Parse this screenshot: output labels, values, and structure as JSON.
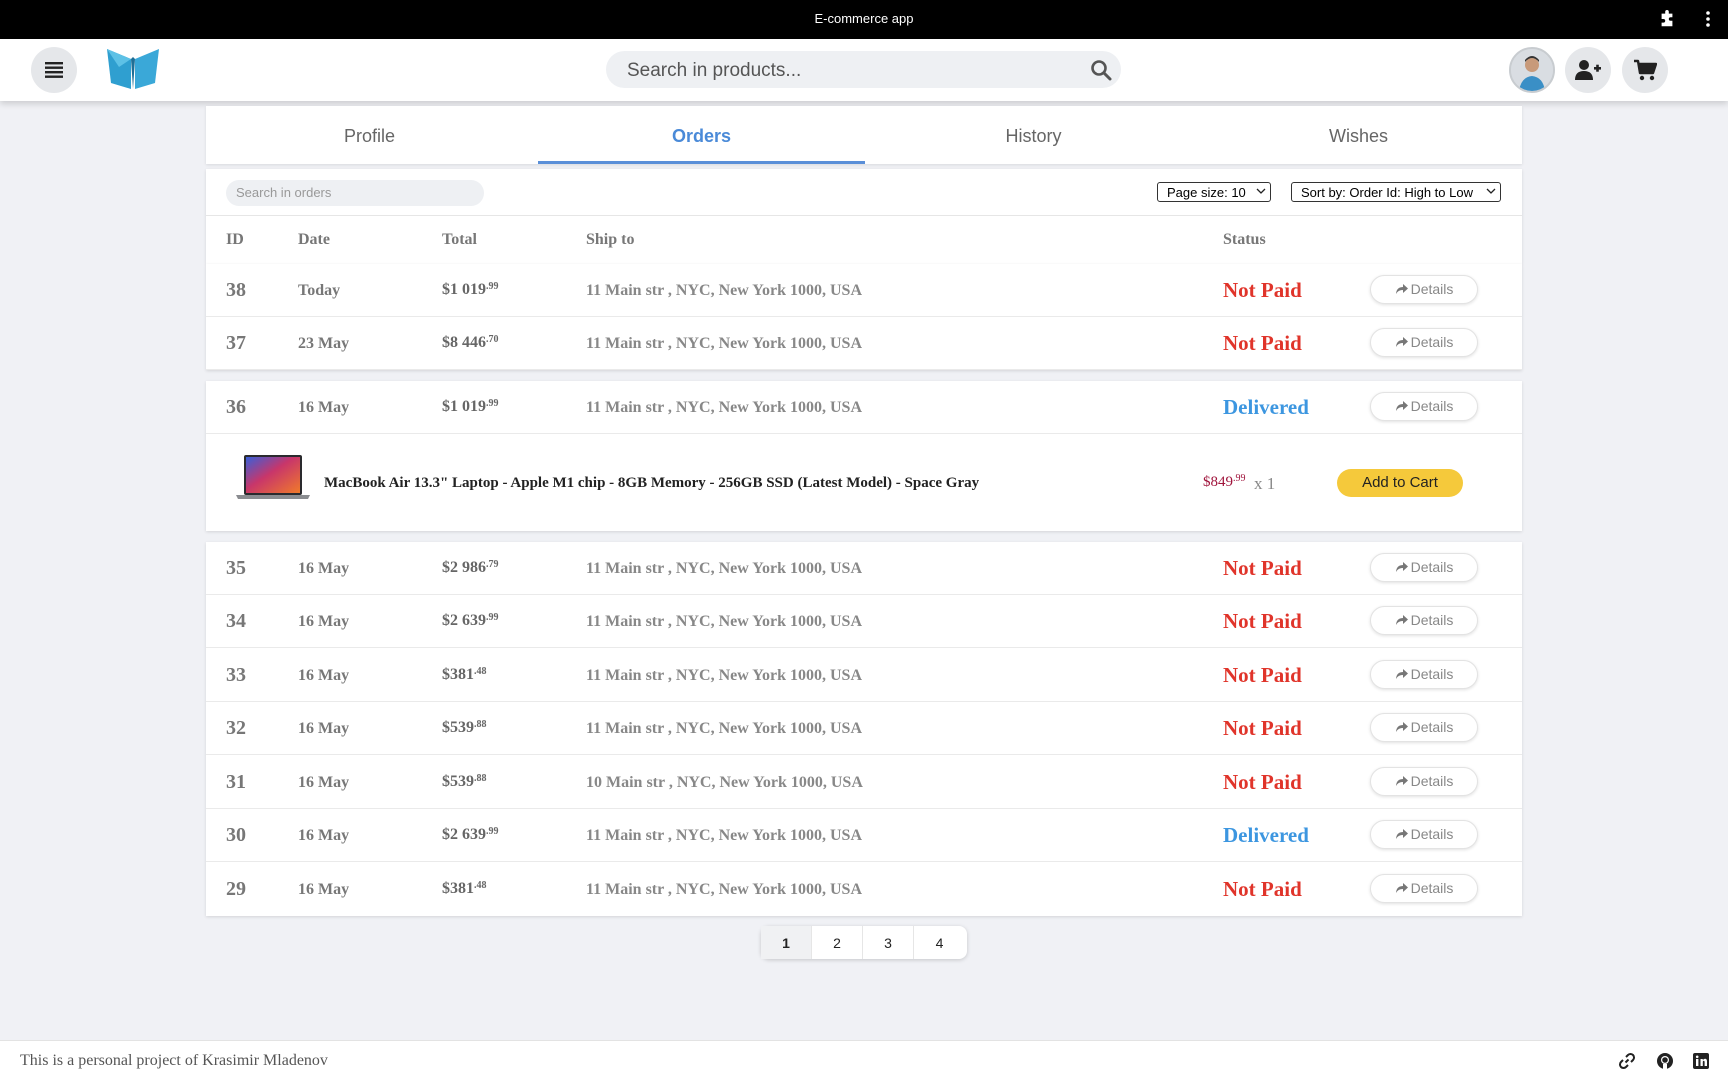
{
  "window": {
    "title": "E-commerce app"
  },
  "header": {
    "search_placeholder": "Search in products..."
  },
  "tabs": [
    {
      "label": "Profile",
      "active": false
    },
    {
      "label": "Orders",
      "active": true
    },
    {
      "label": "History",
      "active": false
    },
    {
      "label": "Wishes",
      "active": false
    }
  ],
  "toolbar": {
    "search_placeholder": "Search in orders",
    "page_size": "Page size: 10",
    "sort_by": "Sort by: Order Id: High to Low"
  },
  "table": {
    "headers": {
      "id": "ID",
      "date": "Date",
      "total": "Total",
      "ship_to": "Ship to",
      "status": "Status"
    },
    "details_label": "Details",
    "rows": [
      {
        "id": "38",
        "date": "Today",
        "total_int": "$1 019",
        "total_cents": ".99",
        "ship_to": "11 Main str , NYC, New York 1000, USA",
        "status": "Not Paid"
      },
      {
        "id": "37",
        "date": "23 May",
        "total_int": "$8 446",
        "total_cents": ".70",
        "ship_to": "11 Main str , NYC, New York 1000, USA",
        "status": "Not Paid"
      },
      {
        "id": "36",
        "date": "16 May",
        "total_int": "$1 019",
        "total_cents": ".99",
        "ship_to": "11 Main str , NYC, New York 1000, USA",
        "status": "Delivered"
      },
      {
        "id": "35",
        "date": "16 May",
        "total_int": "$2 986",
        "total_cents": ".79",
        "ship_to": "11 Main str , NYC, New York 1000, USA",
        "status": "Not Paid"
      },
      {
        "id": "34",
        "date": "16 May",
        "total_int": "$2 639",
        "total_cents": ".99",
        "ship_to": "11 Main str , NYC, New York 1000, USA",
        "status": "Not Paid"
      },
      {
        "id": "33",
        "date": "16 May",
        "total_int": "$381",
        "total_cents": ".48",
        "ship_to": "11 Main str , NYC, New York 1000, USA",
        "status": "Not Paid"
      },
      {
        "id": "32",
        "date": "16 May",
        "total_int": "$539",
        "total_cents": ".88",
        "ship_to": "11 Main str , NYC, New York 1000, USA",
        "status": "Not Paid"
      },
      {
        "id": "31",
        "date": "16 May",
        "total_int": "$539",
        "total_cents": ".88",
        "ship_to": "10 Main str , NYC, New York 1000, USA",
        "status": "Not Paid"
      },
      {
        "id": "30",
        "date": "16 May",
        "total_int": "$2 639",
        "total_cents": ".99",
        "ship_to": "11 Main str , NYC, New York 1000, USA",
        "status": "Delivered"
      },
      {
        "id": "29",
        "date": "16 May",
        "total_int": "$381",
        "total_cents": ".48",
        "ship_to": "11 Main str , NYC, New York 1000, USA",
        "status": "Not Paid"
      }
    ]
  },
  "expanded_item": {
    "name": "MacBook Air 13.3\" Laptop - Apple M1 chip - 8GB Memory - 256GB SSD (Latest Model) - Space Gray",
    "price_int": "$849",
    "price_cents": ".99",
    "quantity": "x 1",
    "add_to_cart": "Add to Cart"
  },
  "pagination": {
    "pages": [
      "1",
      "2",
      "3",
      "4"
    ],
    "current": "1"
  },
  "footer": {
    "text": "This is a personal project of Krasimir Mladenov"
  },
  "colors": {
    "accent": "#4a8ad8",
    "not_paid": "#e0342a",
    "delivered": "#3c96e0",
    "add_to_cart": "#f5c93b",
    "price": "#a0143c"
  }
}
